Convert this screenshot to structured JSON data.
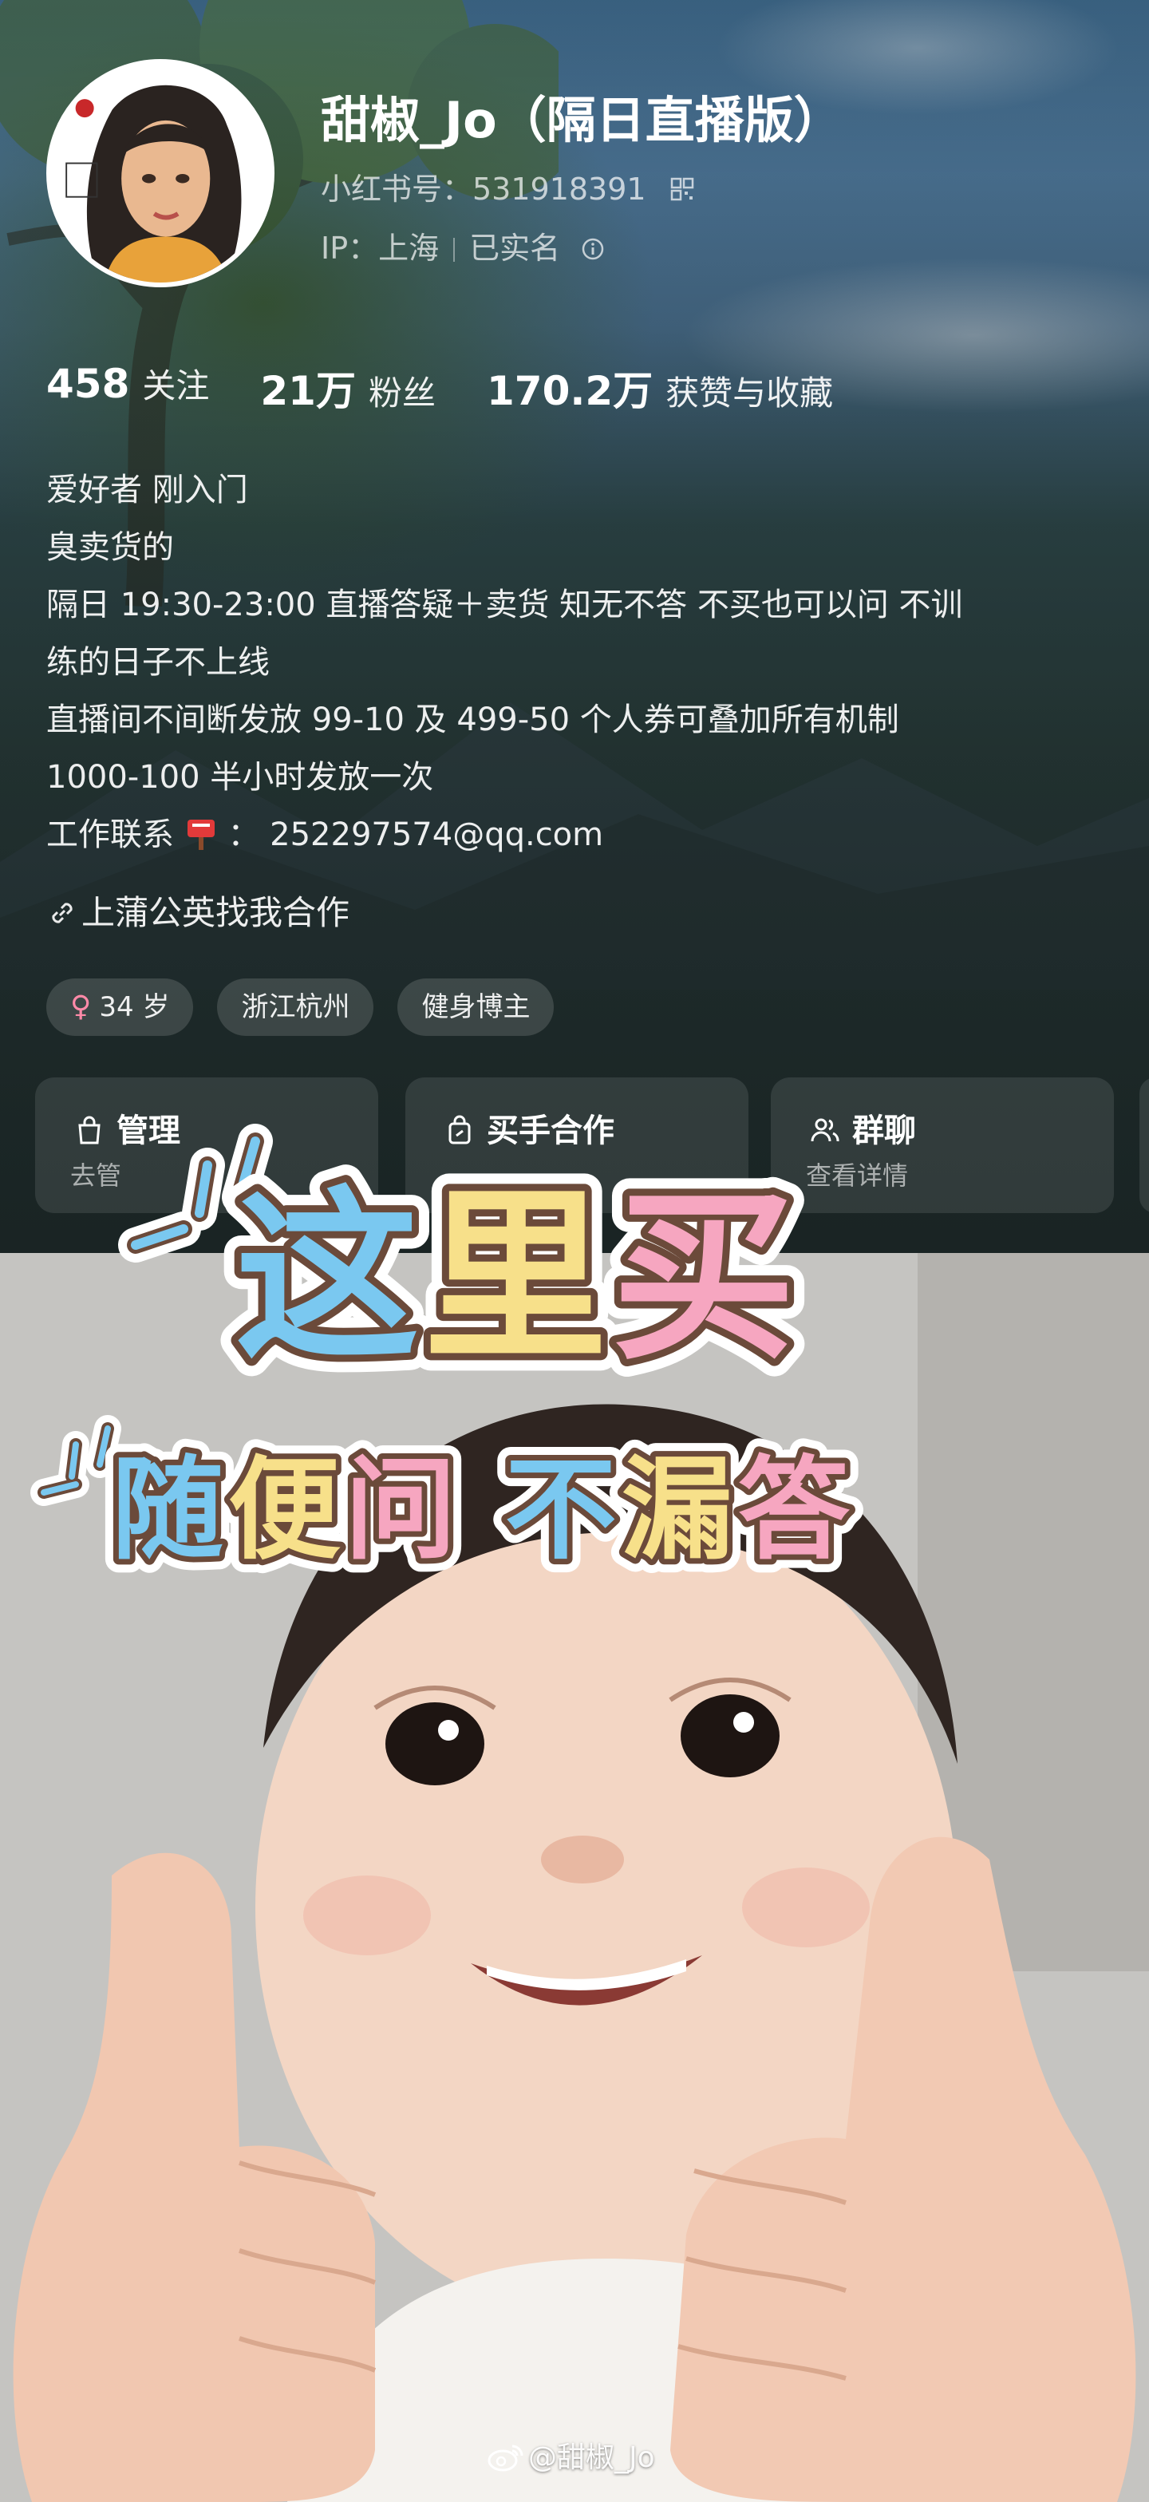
{
  "profile": {
    "name": "甜椒_Jo（隔日直播版）",
    "redbook_id": "小红书号：531918391",
    "ip_label": "IP：上海",
    "verified": "已实名",
    "stats": [
      {
        "num": "458",
        "label": "关注"
      },
      {
        "num": "21万",
        "label": "粉丝"
      },
      {
        "num": "170.2万",
        "label": "获赞与收藏"
      }
    ],
    "bio": [
      "爱好者 刚入门",
      "臭卖货的",
      "隔日 19:30-23:00 直播答疑＋卖货 知无不答 不买也可以问 不训",
      "练的日子不上线",
      "直播间不间断发放 99-10 及 499-50 个人券可叠加所有机制",
      "1000-100 半小时发放一次"
    ],
    "contact_label": "工作联系",
    "contact_value": "：  252297574@qq.com",
    "collab_link": "上蒲公英找我合作",
    "tags": {
      "age": "34 岁",
      "location": "浙江杭州",
      "role": "健身博主"
    },
    "cards": [
      {
        "title": "管理",
        "sub": "去管",
        "icon": "bag-icon"
      },
      {
        "title": "买手合作",
        "sub": "",
        "icon": "shopping-bag-icon"
      },
      {
        "title": "群聊",
        "sub": "查看详情",
        "icon": "group-chat-icon"
      }
    ]
  },
  "meme": {
    "line1": "这里买",
    "line2": "随便问 不漏答"
  },
  "watermark": "@甜椒_Jo",
  "colors": {
    "accent_blue": "#7ac8f0",
    "accent_yellow": "#f7e08a",
    "accent_pink": "#f6a6c0",
    "outline_brown": "#6b4a3a"
  }
}
